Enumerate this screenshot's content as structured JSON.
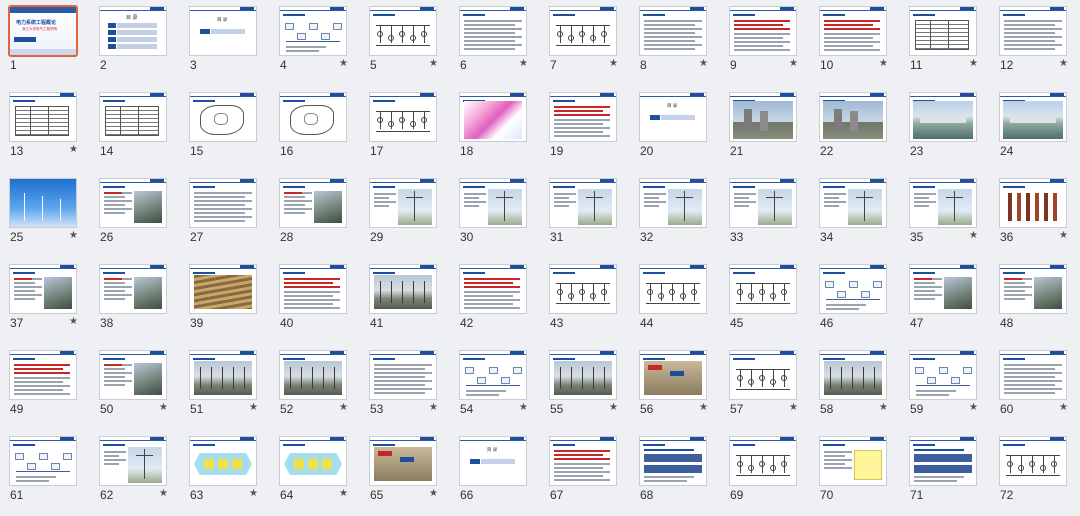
{
  "selected": 1,
  "slides": [
    {
      "n": "1",
      "star": false,
      "kind": "title"
    },
    {
      "n": "2",
      "star": false,
      "kind": "toc"
    },
    {
      "n": "3",
      "star": false,
      "kind": "section"
    },
    {
      "n": "4",
      "star": true,
      "kind": "diagram"
    },
    {
      "n": "5",
      "star": true,
      "kind": "circuit"
    },
    {
      "n": "6",
      "star": true,
      "kind": "text"
    },
    {
      "n": "7",
      "star": true,
      "kind": "circuit"
    },
    {
      "n": "8",
      "star": true,
      "kind": "text"
    },
    {
      "n": "9",
      "star": true,
      "kind": "redtext"
    },
    {
      "n": "10",
      "star": true,
      "kind": "redtext"
    },
    {
      "n": "11",
      "star": true,
      "kind": "table"
    },
    {
      "n": "12",
      "star": true,
      "kind": "text"
    },
    {
      "n": "13",
      "star": true,
      "kind": "table"
    },
    {
      "n": "14",
      "star": false,
      "kind": "table"
    },
    {
      "n": "15",
      "star": false,
      "kind": "map"
    },
    {
      "n": "16",
      "star": false,
      "kind": "map"
    },
    {
      "n": "17",
      "star": false,
      "kind": "circuit"
    },
    {
      "n": "18",
      "star": false,
      "kind": "colormap"
    },
    {
      "n": "19",
      "star": false,
      "kind": "redtext"
    },
    {
      "n": "20",
      "star": false,
      "kind": "section"
    },
    {
      "n": "21",
      "star": false,
      "kind": "photo-plant"
    },
    {
      "n": "22",
      "star": false,
      "kind": "photo-plant"
    },
    {
      "n": "23",
      "star": false,
      "kind": "photo-dam"
    },
    {
      "n": "24",
      "star": false,
      "kind": "photo-dam"
    },
    {
      "n": "25",
      "star": true,
      "kind": "photo-wind"
    },
    {
      "n": "26",
      "star": false,
      "kind": "photo-text"
    },
    {
      "n": "27",
      "star": false,
      "kind": "text"
    },
    {
      "n": "28",
      "star": false,
      "kind": "photo-text"
    },
    {
      "n": "29",
      "star": false,
      "kind": "photo-tower"
    },
    {
      "n": "30",
      "star": false,
      "kind": "photo-tower"
    },
    {
      "n": "31",
      "star": false,
      "kind": "photo-tower"
    },
    {
      "n": "32",
      "star": false,
      "kind": "photo-tower"
    },
    {
      "n": "33",
      "star": false,
      "kind": "photo-tower"
    },
    {
      "n": "34",
      "star": false,
      "kind": "photo-tower"
    },
    {
      "n": "35",
      "star": true,
      "kind": "photo-tower"
    },
    {
      "n": "36",
      "star": true,
      "kind": "photo-insulator"
    },
    {
      "n": "37",
      "star": true,
      "kind": "photo-text"
    },
    {
      "n": "38",
      "star": false,
      "kind": "photo-text"
    },
    {
      "n": "39",
      "star": false,
      "kind": "photo-cable"
    },
    {
      "n": "40",
      "star": false,
      "kind": "redtext"
    },
    {
      "n": "41",
      "star": false,
      "kind": "photo-sub"
    },
    {
      "n": "42",
      "star": false,
      "kind": "redtext"
    },
    {
      "n": "43",
      "star": false,
      "kind": "circuit"
    },
    {
      "n": "44",
      "star": false,
      "kind": "circuit"
    },
    {
      "n": "45",
      "star": false,
      "kind": "circuit"
    },
    {
      "n": "46",
      "star": false,
      "kind": "diagram"
    },
    {
      "n": "47",
      "star": false,
      "kind": "photo-text"
    },
    {
      "n": "48",
      "star": false,
      "kind": "photo-text"
    },
    {
      "n": "49",
      "star": false,
      "kind": "redtext"
    },
    {
      "n": "50",
      "star": true,
      "kind": "photo-text"
    },
    {
      "n": "51",
      "star": true,
      "kind": "photo-sub"
    },
    {
      "n": "52",
      "star": true,
      "kind": "photo-sub"
    },
    {
      "n": "53",
      "star": true,
      "kind": "text"
    },
    {
      "n": "54",
      "star": true,
      "kind": "diagram"
    },
    {
      "n": "55",
      "star": true,
      "kind": "photo-sub"
    },
    {
      "n": "56",
      "star": true,
      "kind": "photo-label"
    },
    {
      "n": "57",
      "star": true,
      "kind": "circuit"
    },
    {
      "n": "58",
      "star": true,
      "kind": "photo-sub"
    },
    {
      "n": "59",
      "star": true,
      "kind": "diagram"
    },
    {
      "n": "60",
      "star": true,
      "kind": "text"
    },
    {
      "n": "61",
      "star": false,
      "kind": "diagram"
    },
    {
      "n": "62",
      "star": true,
      "kind": "photo-tower"
    },
    {
      "n": "63",
      "star": true,
      "kind": "hexagon"
    },
    {
      "n": "64",
      "star": true,
      "kind": "hexagon"
    },
    {
      "n": "65",
      "star": true,
      "kind": "photo-label"
    },
    {
      "n": "66",
      "star": false,
      "kind": "section"
    },
    {
      "n": "67",
      "star": false,
      "kind": "redtext"
    },
    {
      "n": "68",
      "star": false,
      "kind": "bluebox"
    },
    {
      "n": "69",
      "star": false,
      "kind": "circuit"
    },
    {
      "n": "70",
      "star": false,
      "kind": "yellowbox"
    },
    {
      "n": "71",
      "star": false,
      "kind": "bluebox"
    },
    {
      "n": "72",
      "star": false,
      "kind": "circuit"
    }
  ],
  "title_slide": {
    "heading": "电力系统工程概论",
    "sub": "浙江大学电气工程学院"
  },
  "toc_label": "目 录",
  "section_label": "目 录",
  "star_glyph": "★"
}
